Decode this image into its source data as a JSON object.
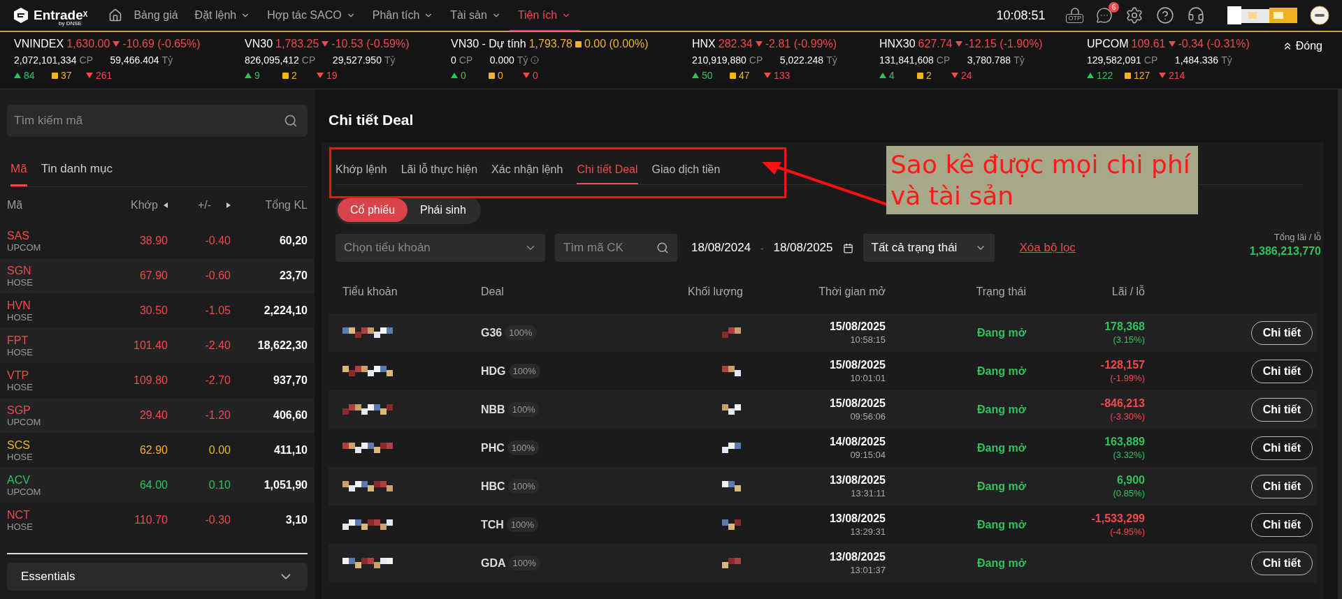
{
  "nav": {
    "logo": "Entrade",
    "logo_mark": "X",
    "logo_sub": "by DNSE",
    "items": [
      {
        "label": "Bảng giá",
        "dropdown": false,
        "selected": false
      },
      {
        "label": "Đặt lệnh",
        "dropdown": true,
        "selected": false
      },
      {
        "label": "Hợp tác SACO",
        "dropdown": true,
        "selected": false
      },
      {
        "label": "Phân tích",
        "dropdown": true,
        "selected": false
      },
      {
        "label": "Tài sản",
        "dropdown": true,
        "selected": false
      },
      {
        "label": "Tiện ích",
        "dropdown": true,
        "selected": true
      }
    ],
    "time": "10:08:51",
    "otp": "OTP",
    "chat_badge": "6"
  },
  "indices": [
    {
      "name": "VNINDEX",
      "value": "1,630.00",
      "change": "-10.69 (-0.65%)",
      "kind": "down",
      "volume": "2,072,101,334",
      "volume_unit": "CP",
      "turnover": "59,466.404",
      "turnover_unit": "Tỷ",
      "up": "84",
      "flat": "37",
      "down": "261"
    },
    {
      "name": "VN30",
      "value": "1,783.25",
      "change": "-10.53 (-0.59%)",
      "kind": "down",
      "volume": "826,095,412",
      "volume_unit": "CP",
      "turnover": "29,527.950",
      "turnover_unit": "Tỷ",
      "up": "9",
      "flat": "2",
      "down": "19"
    },
    {
      "name": "VN30 - Dự tính",
      "value": "1,793.78",
      "change": "0.00 (0.00%)",
      "kind": "flat",
      "volume": "0",
      "volume_unit": "CP",
      "turnover": "0.000",
      "turnover_unit": "Tỷ",
      "info": true,
      "up": "0",
      "flat": "0",
      "down": "0"
    },
    {
      "name": "HNX",
      "value": "282.34",
      "change": "-2.81 (-0.99%)",
      "kind": "down",
      "volume": "210,919,880",
      "volume_unit": "CP",
      "turnover": "5,022.248",
      "turnover_unit": "Tỷ",
      "up": "50",
      "flat": "47",
      "down": "133"
    },
    {
      "name": "HNX30",
      "value": "627.74",
      "change": "-12.15 (-1.90%)",
      "kind": "down",
      "volume": "131,841,608",
      "volume_unit": "CP",
      "turnover": "3,780.788",
      "turnover_unit": "Tỷ",
      "up": "4",
      "flat": "2",
      "down": "24"
    },
    {
      "name": "UPCOM",
      "value": "109.61",
      "change": "-0.34 (-0.31%)",
      "kind": "down",
      "volume": "129,582,091",
      "volume_unit": "CP",
      "turnover": "1,484.336",
      "turnover_unit": "Tỷ",
      "up": "122",
      "flat": "127",
      "down": "214"
    }
  ],
  "collapse_button": "Đóng",
  "sidebar": {
    "search": {
      "placeholder": "Tìm kiếm mã"
    },
    "tabs": [
      {
        "label": "Mã",
        "selected": true
      },
      {
        "label": "Tin danh mục",
        "selected": false
      }
    ],
    "columns": [
      "Mã",
      "Khớp",
      "+/-",
      "Tổng KL"
    ],
    "rows": [
      {
        "symbol": "SAS",
        "exchange": "UPCOM",
        "price": "38.90",
        "change": "-0.40",
        "volume": "60,20",
        "kind": "down"
      },
      {
        "symbol": "SGN",
        "exchange": "HOSE",
        "price": "67.90",
        "change": "-0.60",
        "volume": "23,70",
        "kind": "down"
      },
      {
        "symbol": "HVN",
        "exchange": "HOSE",
        "price": "30.50",
        "change": "-1.05",
        "volume": "2,224,10",
        "kind": "down"
      },
      {
        "symbol": "FPT",
        "exchange": "HOSE",
        "price": "101.40",
        "change": "-2.40",
        "volume": "18,622,30",
        "kind": "down"
      },
      {
        "symbol": "VTP",
        "exchange": "HOSE",
        "price": "109.80",
        "change": "-2.70",
        "volume": "937,70",
        "kind": "down"
      },
      {
        "symbol": "SGP",
        "exchange": "UPCOM",
        "price": "29.40",
        "change": "-1.20",
        "volume": "406,60",
        "kind": "down"
      },
      {
        "symbol": "SCS",
        "exchange": "HOSE",
        "price": "62.90",
        "change": "0.00",
        "volume": "411,10",
        "kind": "flat"
      },
      {
        "symbol": "ACV",
        "exchange": "UPCOM",
        "price": "64.00",
        "change": "0.10",
        "volume": "1,051,90",
        "kind": "up"
      },
      {
        "symbol": "NCT",
        "exchange": "HOSE",
        "price": "110.70",
        "change": "-0.30",
        "volume": "3,10",
        "kind": "down"
      }
    ],
    "essentials": "Essentials"
  },
  "main": {
    "title": "Chi tiết Deal",
    "tabs": [
      {
        "label": "Khớp lệnh",
        "selected": false
      },
      {
        "label": "Lãi lỗ thực hiện",
        "selected": false
      },
      {
        "label": "Xác nhận lệnh",
        "selected": false
      },
      {
        "label": "Chi tiết Deal",
        "selected": true
      },
      {
        "label": "Giao dịch tiền",
        "selected": false
      }
    ],
    "segments": [
      {
        "label": "Cổ phiếu",
        "selected": true
      },
      {
        "label": "Phái sinh",
        "selected": false
      }
    ],
    "filters": {
      "account": {
        "placeholder": "Chọn tiểu khoản"
      },
      "symbol": {
        "placeholder": "Tìm mã CK"
      },
      "date_from": "18/08/2024",
      "date_sep": "-",
      "date_to": "18/08/2025",
      "status": "Tất cả trạng thái",
      "clear": "Xóa bộ lọc"
    },
    "total": {
      "label": "Tổng lãi / lỗ",
      "value": "1,386,213,770"
    },
    "table": {
      "columns": [
        "Tiểu khoản",
        "Deal",
        "Khối lượng",
        "Thời gian mở",
        "Trạng thái",
        "Lãi / lỗ"
      ],
      "rows": [
        {
          "deal": "G36",
          "ratio": "100%",
          "date": "15/08/2025",
          "time": "10:58:15",
          "status": "Đang mở",
          "pnl": "178,368",
          "pnl_pct": "(3.15%)",
          "kind": "up",
          "action": "Chi tiết"
        },
        {
          "deal": "HDG",
          "ratio": "100%",
          "date": "15/08/2025",
          "time": "10:01:01",
          "status": "Đang mở",
          "pnl": "-128,157",
          "pnl_pct": "(-1.99%)",
          "kind": "down",
          "action": "Chi tiết"
        },
        {
          "deal": "NBB",
          "ratio": "100%",
          "date": "15/08/2025",
          "time": "09:56:06",
          "status": "Đang mở",
          "pnl": "-846,213",
          "pnl_pct": "(-3.30%)",
          "kind": "down",
          "action": "Chi tiết"
        },
        {
          "deal": "PHC",
          "ratio": "100%",
          "date": "14/08/2025",
          "time": "09:15:04",
          "status": "Đang mở",
          "pnl": "163,889",
          "pnl_pct": "(3.32%)",
          "kind": "up",
          "action": "Chi tiết"
        },
        {
          "deal": "HBC",
          "ratio": "100%",
          "date": "13/08/2025",
          "time": "13:31:11",
          "status": "Đang mở",
          "pnl": "6,900",
          "pnl_pct": "(0.85%)",
          "kind": "up",
          "action": "Chi tiết"
        },
        {
          "deal": "TCH",
          "ratio": "100%",
          "date": "13/08/2025",
          "time": "13:29:31",
          "status": "Đang mở",
          "pnl": "-1,533,299",
          "pnl_pct": "(-4.95%)",
          "kind": "down",
          "action": "Chi tiết"
        },
        {
          "deal": "GDA",
          "ratio": "100%",
          "date": "13/08/2025",
          "time": "13:01:37",
          "status": "Đang mở",
          "action": "Chi tiết"
        }
      ]
    }
  },
  "annotation": {
    "text": "Sao kê được mọi chi phí và tài sản"
  }
}
